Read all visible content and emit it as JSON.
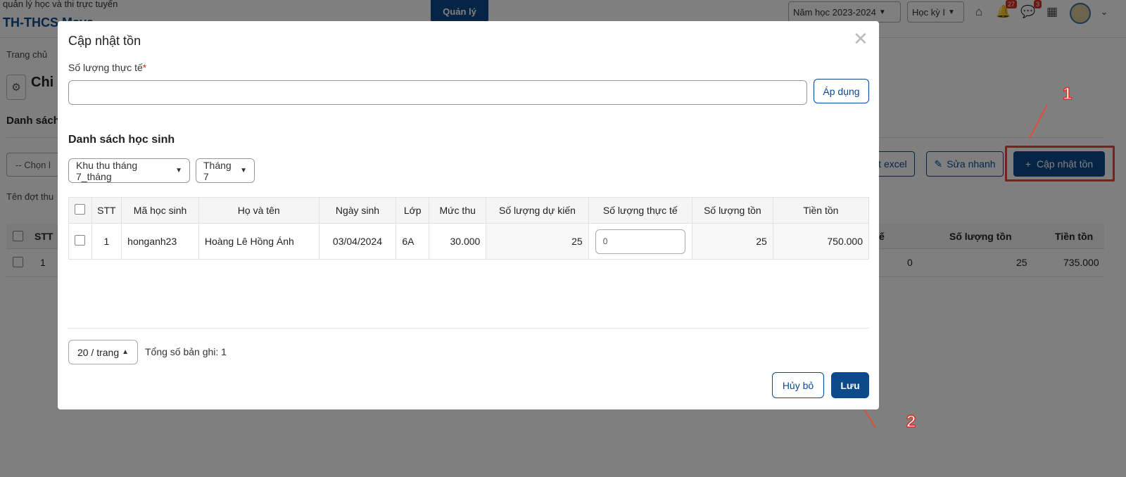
{
  "app": {
    "subtitle": "quản lý học và thi trực tuyến",
    "title": "TH-THCS Maya",
    "menu_label": "Quản lý"
  },
  "header": {
    "school_year": "Năm học 2023-2024",
    "semester": "Học kỳ I",
    "notification_count": "27",
    "message_count": "3",
    "icons": [
      "home-icon",
      "bell-icon",
      "chat-icon",
      "grid-icon",
      "chevron-down-icon"
    ]
  },
  "background": {
    "breadcrumb": "Trang chủ",
    "page_title": "Chi t",
    "list_heading": "Danh sách",
    "class_select": "-- Chọn l",
    "export_excel": "ất excel",
    "quick_edit": "Sửa nhanh",
    "update_stock": "Cập nhật tồn",
    "period_label": "Tên đợt thu",
    "table": {
      "headers": [
        "STT",
        "ế",
        "Số lượng tồn",
        "Tiền tồn"
      ],
      "row": [
        "1",
        "0",
        "25",
        "735.000"
      ]
    }
  },
  "annotations": {
    "step1": "1",
    "step2": "2"
  },
  "modal": {
    "title": "Cập nhật tồn",
    "field_label": "Số lượng thực tế",
    "field_value": "",
    "apply_label": "Áp dụng",
    "student_list_heading": "Danh sách học sinh",
    "filters": {
      "fee_period": "Khu thu tháng 7_tháng",
      "month": "Tháng 7"
    },
    "table": {
      "headers": [
        "STT",
        "Mã học sinh",
        "Họ và tên",
        "Ngày sinh",
        "Lớp",
        "Mức thu",
        "Số lượng dự kiến",
        "Số lượng thực tế",
        "Số lượng tồn",
        "Tiền tồn"
      ],
      "rows": [
        {
          "stt": "1",
          "student_code": "honganh23",
          "full_name": "Hoàng Lê Hồng Ánh",
          "dob": "03/04/2024",
          "class": "6A",
          "fee": "30.000",
          "expected_qty": "25",
          "actual_qty": "0",
          "stock_qty": "25",
          "stock_amount": "750.000"
        }
      ]
    },
    "pagination": {
      "page_size": "20 / trang",
      "total": "Tổng số bản ghi: 1"
    },
    "cancel_label": "Hủy bỏ",
    "save_label": "Lưu"
  },
  "colors": {
    "primary": "#0d4a8c",
    "annotation": "#e04b3b",
    "badge": "#d93025"
  }
}
